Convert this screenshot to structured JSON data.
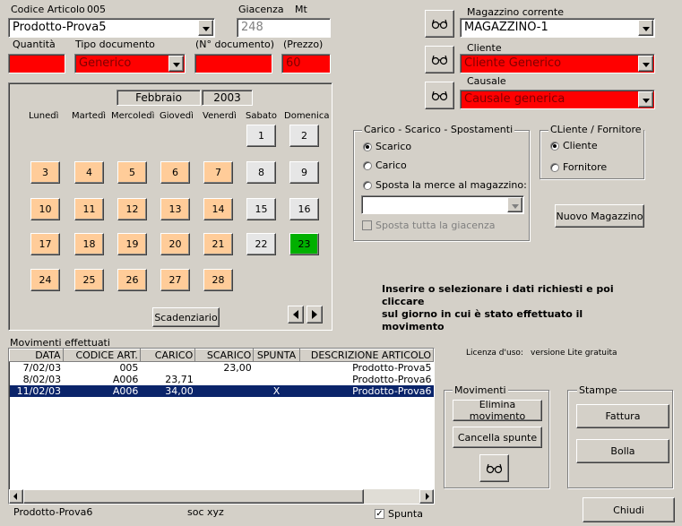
{
  "header": {
    "codice_articolo_label": "Codice Articolo",
    "codice_articolo_code": "005",
    "articolo_value": "Prodotto-Prova5",
    "giacenza_label": "Giacenza",
    "unit_label": "Mt",
    "giacenza_value": "248",
    "quantita_label": "Quantità",
    "tipo_documento_label": "Tipo documento",
    "tipo_documento_value": "Generico",
    "n_documento_label": "(N° documento)",
    "prezzo_label": "(Prezzo)",
    "prezzo_value": "60"
  },
  "right_top": {
    "magazzino_label": "Magazzino corrente",
    "magazzino_value": "MAGAZZINO-1",
    "cliente_label": "Cliente",
    "cliente_value": "Cliente Generico",
    "causale_label": "Causale",
    "causale_value": "Causale generica"
  },
  "calendar": {
    "month": "Febbraio",
    "year": "2003",
    "weekdays": [
      "Lunedì",
      "Martedì",
      "Mercoledì",
      "Giovedì",
      "Venerdì",
      "Sabato",
      "Domenica"
    ],
    "days": [
      "1",
      "2",
      "3",
      "4",
      "5",
      "6",
      "7",
      "8",
      "9",
      "10",
      "11",
      "12",
      "13",
      "14",
      "15",
      "16",
      "17",
      "18",
      "19",
      "20",
      "21",
      "22",
      "23",
      "24",
      "25",
      "26",
      "27",
      "28"
    ],
    "selected_day": "23",
    "scadenziario_label": "Scadenziario",
    "prev_icon": "triangle-left",
    "next_icon": "triangle-right"
  },
  "movimento_frame": {
    "title": "Carico - Scarico -  Spostamenti",
    "option_scarico": "Scarico",
    "option_carico": "Carico",
    "option_sposta": "Sposta la merce al magazzino:",
    "selected": "Scarico",
    "sposta_giacenza_label": "Sposta tutta la giacenza"
  },
  "cf_frame": {
    "title": "CLiente / Fornitore",
    "option_cliente": "Cliente",
    "option_fornitore": "Fornitore",
    "selected": "Cliente"
  },
  "nuovo_magazzino_label": "Nuovo Magazzino",
  "instructions": {
    "line1": "Inserire o selezionare i dati richiesti e poi cliccare",
    "line2": "sul   giorno in cui è stato effettuato il movimento"
  },
  "movimenti": {
    "title": "Movimenti effettuati",
    "columns": [
      "DATA",
      "CODICE ART.",
      "CARICO",
      "SCARICO",
      "SPUNTA",
      "DESCRIZIONE ARTICOLO"
    ],
    "rows": [
      [
        "7/02/03",
        "005",
        "",
        "23,00",
        "",
        "Prodotto-Prova5"
      ],
      [
        "8/02/03",
        "A006",
        "23,71",
        "",
        "",
        "Prodotto-Prova6"
      ],
      [
        "11/02/03",
        "A006",
        "34,00",
        "",
        "X",
        "Prodotto-Prova6"
      ]
    ],
    "selected_row": 2
  },
  "licenza": {
    "label": "Licenza d'uso:",
    "value": "versione Lite gratuita"
  },
  "movimenti_frame": {
    "title": "Movimenti",
    "elimina_label": "Elimina movimento",
    "cancella_label": "Cancella spunte"
  },
  "stampe_frame": {
    "title": "Stampe",
    "fattura_label": "Fattura",
    "bolla_label": "Bolla"
  },
  "status": {
    "articolo": "Prodotto-Prova6",
    "societa": "soc xyz",
    "spunta_label": "Spunta",
    "spunta_checked": true
  },
  "chiudi_label": "Chiudi",
  "colors": {
    "background": "#d4d0c8",
    "required_field": "#ff0000",
    "weekday_cell": "#ffcc99",
    "weekend_cell": "#e6e6e6",
    "selected_day": "#00b000",
    "selected_row": "#0a246a"
  }
}
